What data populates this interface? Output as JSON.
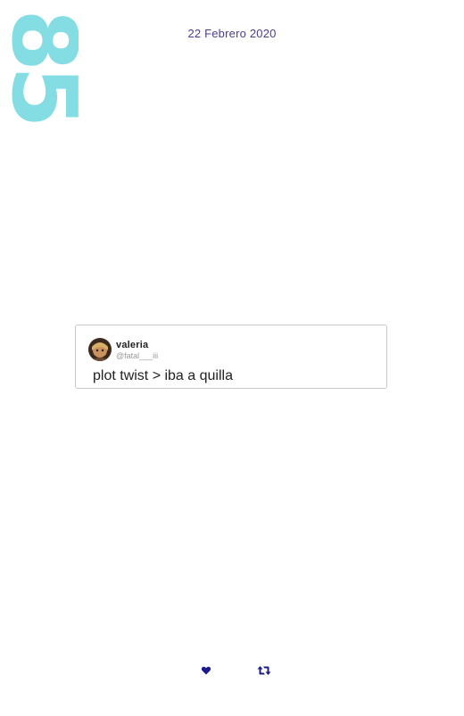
{
  "page_number": "85",
  "date": "22 Febrero 2020",
  "tweet": {
    "display_name": "valeria",
    "handle": "@fatal___iii",
    "text": "plot twist > iba a quilla"
  },
  "actions": {
    "like_icon": "heart-icon",
    "retweet_icon": "retweet-icon"
  },
  "colors": {
    "page_number": "#84dde3",
    "date": "#4a3f8f",
    "icons": "#1a1a8c"
  }
}
